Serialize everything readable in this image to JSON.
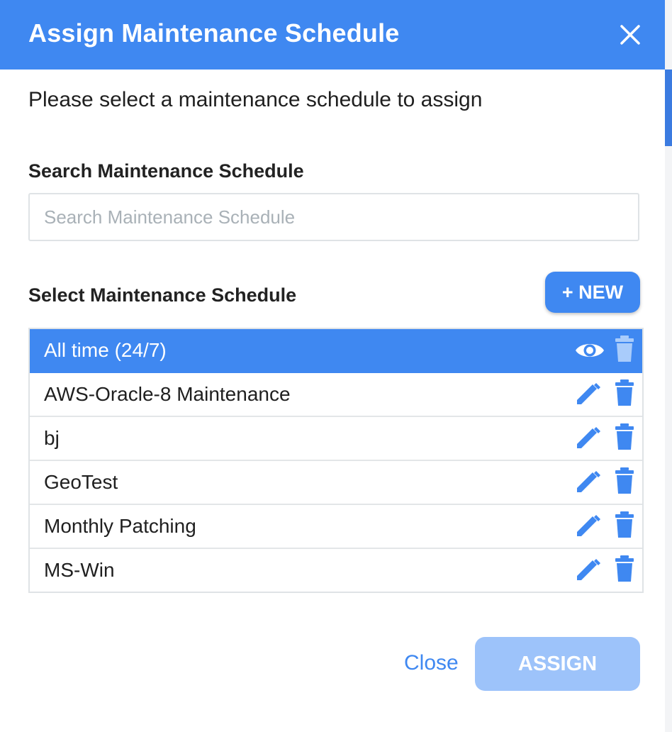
{
  "dialog": {
    "title": "Assign Maintenance Schedule",
    "close_icon": "close-icon",
    "intro_text": "Please select a maintenance schedule to assign"
  },
  "search": {
    "label": "Search Maintenance Schedule",
    "placeholder": "Search Maintenance Schedule",
    "value": ""
  },
  "schedules": {
    "label": "Select Maintenance Schedule",
    "new_button_label": "+ NEW",
    "items": [
      {
        "name": "All time (24/7)",
        "selected": true,
        "action_icon": "eye-icon",
        "delete_icon": "trash-icon"
      },
      {
        "name": "AWS-Oracle-8 Maintenance",
        "selected": false,
        "action_icon": "pencil-icon",
        "delete_icon": "trash-icon"
      },
      {
        "name": "bj",
        "selected": false,
        "action_icon": "pencil-icon",
        "delete_icon": "trash-icon"
      },
      {
        "name": "GeoTest",
        "selected": false,
        "action_icon": "pencil-icon",
        "delete_icon": "trash-icon"
      },
      {
        "name": "Monthly Patching",
        "selected": false,
        "action_icon": "pencil-icon",
        "delete_icon": "trash-icon"
      },
      {
        "name": "MS-Win",
        "selected": false,
        "action_icon": "pencil-icon",
        "delete_icon": "trash-icon"
      }
    ]
  },
  "footer": {
    "close_label": "Close",
    "assign_label": "ASSIGN",
    "assign_disabled": true
  },
  "colors": {
    "primary": "#3f88f1",
    "primary_disabled": "#9dc3fa",
    "border": "#dfe3e6"
  }
}
